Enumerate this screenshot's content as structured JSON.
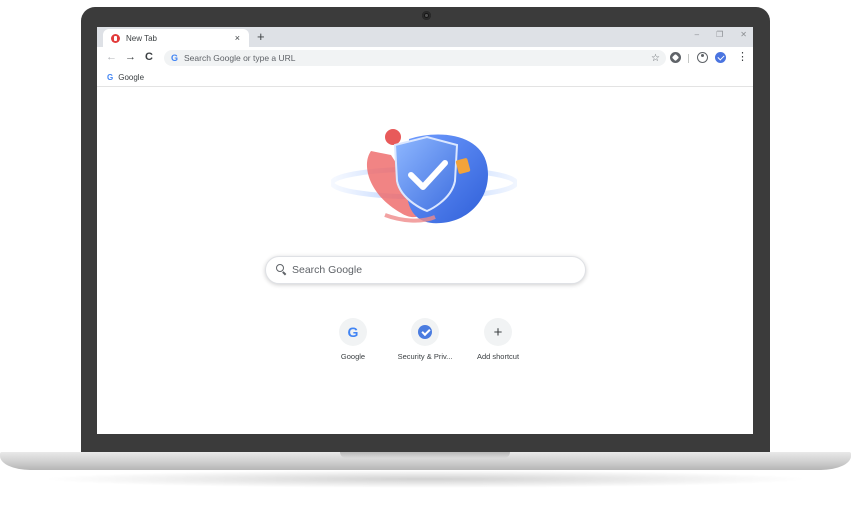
{
  "browser": {
    "tab": {
      "title": "New Tab",
      "close_glyph": "×"
    },
    "new_tab_glyph": "+",
    "window_controls": {
      "minimize": "–",
      "restore": "❐",
      "close": "✕"
    },
    "nav": {
      "back": "←",
      "forward": "→",
      "reload": "C"
    },
    "omnibox": {
      "icon": "G",
      "placeholder": "Search Google or type a URL",
      "star": "☆"
    },
    "menu_glyph": "⋮",
    "bookmarks": [
      {
        "icon": "G",
        "label": "Google"
      }
    ]
  },
  "ntp": {
    "search": {
      "placeholder": "Search Google"
    },
    "shortcuts": [
      {
        "label": "Google",
        "icon": "google-logo-icon",
        "glyph": "G"
      },
      {
        "label": "Security & Priv...",
        "icon": "shield-check-icon",
        "glyph": ""
      },
      {
        "label": "Add shortcut",
        "icon": "plus-icon",
        "glyph": "+"
      }
    ]
  },
  "colors": {
    "accent_blue": "#4285f4",
    "bezel": "#3b3b3b",
    "tab_strip": "#dee1e6",
    "favicon_red": "#e23b3b"
  }
}
